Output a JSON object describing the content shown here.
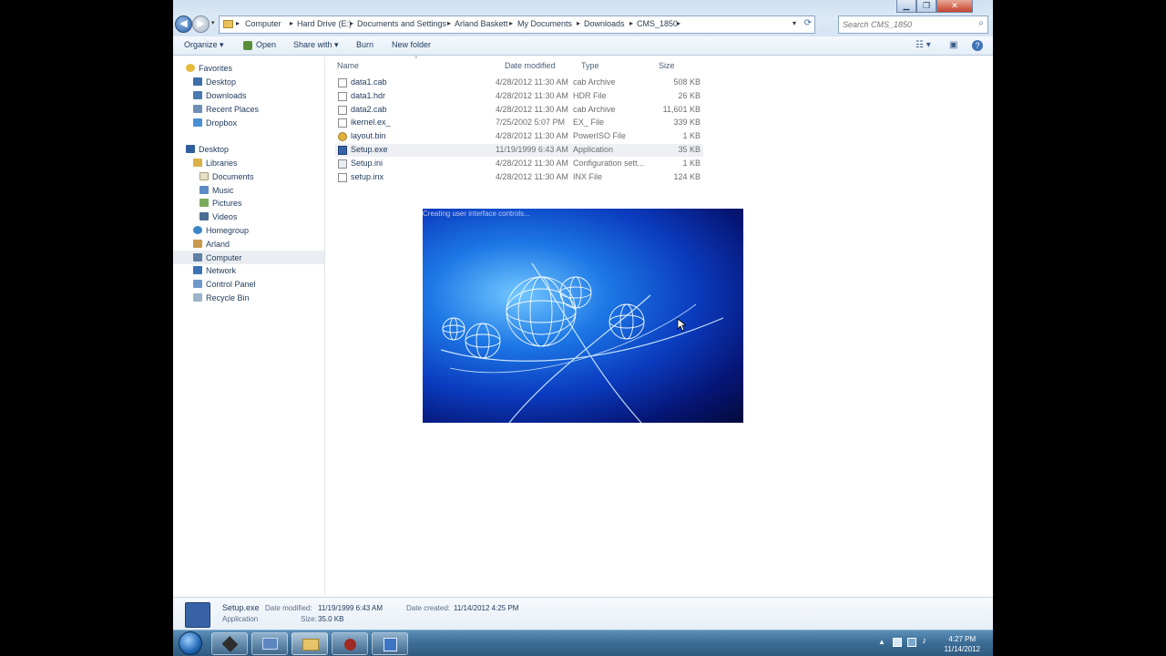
{
  "address": {
    "crumbs": [
      "Computer",
      "Hard Drive (E:)",
      "Documents and Settings",
      "Arland Baskett",
      "My Documents",
      "Downloads",
      "CMS_1850"
    ]
  },
  "search": {
    "placeholder": "Search CMS_1850"
  },
  "toolbar": {
    "organize": "Organize ▾",
    "open": "Open",
    "share": "Share with ▾",
    "burn": "Burn",
    "new_folder": "New folder"
  },
  "sidebar": {
    "favorites_header": "Favorites",
    "favorites": [
      "Desktop",
      "Downloads",
      "Recent Places",
      "Dropbox"
    ],
    "desktop_header": "Desktop",
    "libraries_header": "Libraries",
    "libraries": [
      "Documents",
      "Music",
      "Pictures",
      "Videos"
    ],
    "other": [
      "Homegroup",
      "Arland",
      "Computer",
      "Network",
      "Control Panel",
      "Recycle Bin"
    ]
  },
  "columns": {
    "name": "Name",
    "date": "Date modified",
    "type": "Type",
    "size": "Size"
  },
  "files": [
    {
      "name": "data1.cab",
      "date": "4/28/2012 11:30 AM",
      "type": "cab Archive",
      "size": "508 KB"
    },
    {
      "name": "data1.hdr",
      "date": "4/28/2012 11:30 AM",
      "type": "HDR File",
      "size": "26 KB"
    },
    {
      "name": "data2.cab",
      "date": "4/28/2012 11:30 AM",
      "type": "cab Archive",
      "size": "11,601 KB"
    },
    {
      "name": "ikernel.ex_",
      "date": "7/25/2002 5:07 PM",
      "type": "EX_ File",
      "size": "339 KB"
    },
    {
      "name": "layout.bin",
      "date": "4/28/2012 11:30 AM",
      "type": "PowerISO File",
      "size": "1 KB"
    },
    {
      "name": "Setup.exe",
      "date": "11/19/1999 6:43 AM",
      "type": "Application",
      "size": "35 KB"
    },
    {
      "name": "Setup.ini",
      "date": "4/28/2012 11:30 AM",
      "type": "Configuration sett...",
      "size": "1 KB"
    },
    {
      "name": "setup.inx",
      "date": "4/28/2012 11:30 AM",
      "type": "INX File",
      "size": "124 KB"
    }
  ],
  "splash": {
    "message": "Creating user interface controls..."
  },
  "details": {
    "name": "Setup.exe",
    "kind": "Application",
    "modified_label": "Date modified:",
    "modified": "11/19/1999 6:43 AM",
    "created_label": "Date created:",
    "created": "11/14/2012 4:25 PM",
    "size_label": "Size:",
    "size": "35.0 KB"
  },
  "taskbar": {
    "time": "4:27 PM",
    "date": "11/14/2012"
  },
  "colors": {
    "accent": "#1e395b",
    "taskbar": "#3e6f98",
    "splash": "#0b3cc0"
  }
}
